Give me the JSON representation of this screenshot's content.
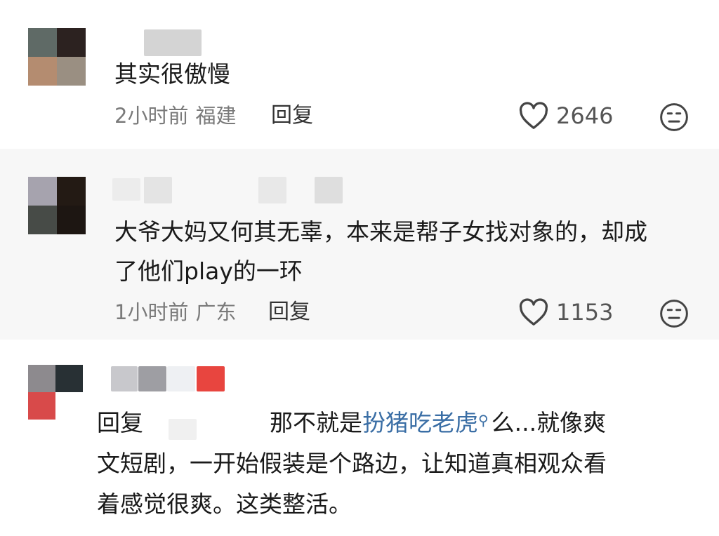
{
  "comments": [
    {
      "text_lines": [
        "其实很傲慢"
      ],
      "time": "2小时前",
      "location": "福建",
      "reply_label": "回复",
      "likes": "2646"
    },
    {
      "text_lines": [
        "大爷大妈又何其无辜，本来是帮子女找对象的，却成",
        "了他们play的一环"
      ],
      "time": "1小时前",
      "location": "广东",
      "reply_label": "回复",
      "likes": "1153"
    },
    {
      "reply_prefix": "回复",
      "text_after_name": "那不就是",
      "link_text": "扮猪吃老虎",
      "text_after_link": "么...就像爽",
      "text_lines": [
        "文短剧，一开始假装是个路边，让知道真相观众看",
        "着感觉很爽。这类整活。"
      ]
    }
  ],
  "icons": {
    "like": "heart-outline-icon",
    "dislike": "meh-face-icon",
    "search": "magnifier-icon"
  }
}
